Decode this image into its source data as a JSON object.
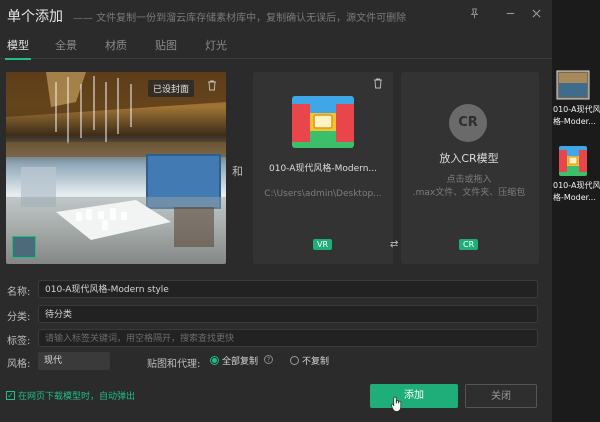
{
  "window": {
    "title": "单个添加",
    "subtitle": "—— 文件复制一份到溜云库存储素材库中，复制确认无误后，源文件可删除"
  },
  "tabs": [
    {
      "label": "模型"
    },
    {
      "label": "全景"
    },
    {
      "label": "材质"
    },
    {
      "label": "贴图"
    },
    {
      "label": "灯光"
    }
  ],
  "preview": {
    "badge": "已设封面"
  },
  "connector": "和",
  "vr_card": {
    "file_name": "010-A现代风格-Modern...",
    "path": "C:\\Users\\admin\\Desktop...",
    "tag": "VR"
  },
  "cr_card": {
    "circle_text": "CR",
    "title": "放入CR模型",
    "hint_line1": "点击或拖入",
    "hint_line2": ".max文件、文件夹、压缩包",
    "tag": "CR"
  },
  "form": {
    "name_label": "名称:",
    "name_value": "010-A现代风格-Modern style",
    "category_label": "分类:",
    "category_value": "待分类",
    "tags_label": "标签:",
    "tags_placeholder": "请输入标签关键词，用空格隔开，搜索查找更快",
    "style_label": "风格:",
    "style_value": "现代",
    "texture_label": "贴图和代理:",
    "radio_copy_all": "全部复制",
    "radio_no_copy": "不复制"
  },
  "footer": {
    "checkbox_label": "在网页下载模型时，自动弹出",
    "add_button": "添加",
    "close_button": "关闭"
  },
  "desktop": {
    "icons": [
      {
        "line1": "010-A现代风",
        "line2": "格-Moder..."
      },
      {
        "line1": "010-A现代风",
        "line2": "格-Moder..."
      }
    ]
  },
  "colors": {
    "accent": "#1fbf85",
    "button": "#1fae79",
    "dialog_bg": "#2b2b2b"
  }
}
